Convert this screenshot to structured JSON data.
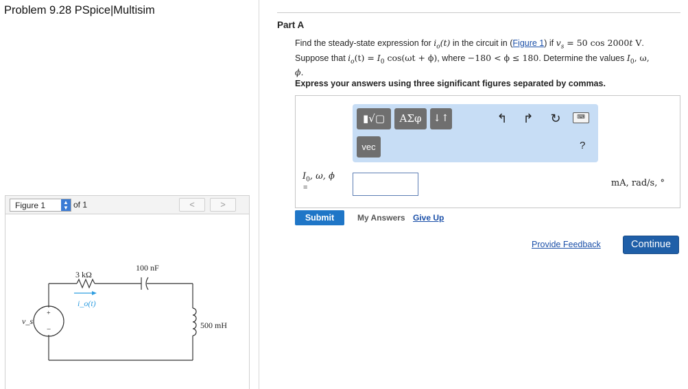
{
  "problem": {
    "title": "Problem 9.28 PSpice|Multisim"
  },
  "figure_nav": {
    "selected": "Figure 1",
    "of_text": "of 1",
    "prev_symbol": "<",
    "next_symbol": ">"
  },
  "circuit": {
    "resistor_label": "3 kΩ",
    "capacitor_label": "100 nF",
    "inductor_label": "500 mH",
    "current_label": "i_o(t)",
    "source_label": "v_s",
    "plus_sign": "+",
    "minus_sign": "−"
  },
  "part": {
    "label": "Part A",
    "question_line1_a": "Find the steady-state expression for ",
    "question_io_t": "i",
    "question_io_sub": "o",
    "question_io_arg": "(t)",
    "question_line1_b": " in the circuit in (",
    "figure_link": "Figure 1",
    "question_line1_c": ") if ",
    "question_vs": "v",
    "question_vs_sub": "s",
    "question_vs_expr": " = 50 cos 2000",
    "question_vs_t": "t",
    "question_vs_unit": " V",
    "question_line2_a": "Suppose that ",
    "question_line2_expr1": "(t) = ",
    "question_line2_I0": "I",
    "question_line2_I0sub": "0",
    "question_line2_expr2": " cos(ωt + ϕ)",
    "question_line2_b": ", where ",
    "question_line2_range": "−180 < ϕ ≤ 180",
    "question_line2_c": ". Determine the values ",
    "question_line2_vals": "I",
    "question_line2_vals_sub": "0",
    "question_line2_vals_rest": ", ω,",
    "question_line3": "ϕ.",
    "instruction": "Express your answers using three significant figures separated by commas."
  },
  "toolbar": {
    "templates_symbol": "▮√▢",
    "greek_symbol": "ΑΣφ",
    "arrows_symbol": "↓↑",
    "vec_label": "vec",
    "undo_symbol": "↰",
    "redo_symbol": "↱",
    "reset_symbol": "↻",
    "keyboard_symbol": "⌨",
    "help_symbol": "?"
  },
  "answer": {
    "label_I": "I",
    "label_sub": "0",
    "label_rest": ", ω, ϕ",
    "equals": "=",
    "value": "",
    "units": "mA, rad/s, °"
  },
  "actions": {
    "submit": "Submit",
    "my_answers": "My Answers",
    "give_up": "Give Up",
    "provide_feedback": "Provide Feedback",
    "continue": "Continue"
  }
}
